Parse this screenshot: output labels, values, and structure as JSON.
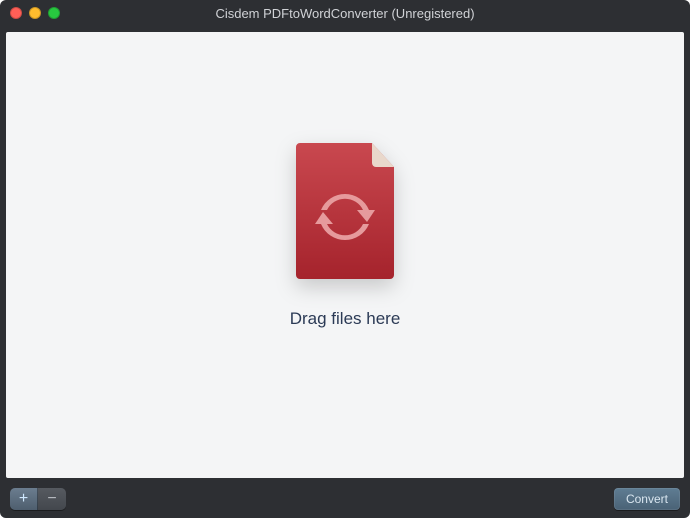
{
  "window": {
    "title": "Cisdem PDFtoWordConverter (Unregistered)"
  },
  "main": {
    "drop_hint": "Drag files here"
  },
  "toolbar": {
    "add_label": "+",
    "remove_label": "−",
    "convert_label": "Convert"
  },
  "icon": {
    "file_color": "#b52932",
    "file_color_light": "#c9484f",
    "fold_color": "#e7cfc2",
    "arrow_color": "#e28f91"
  }
}
